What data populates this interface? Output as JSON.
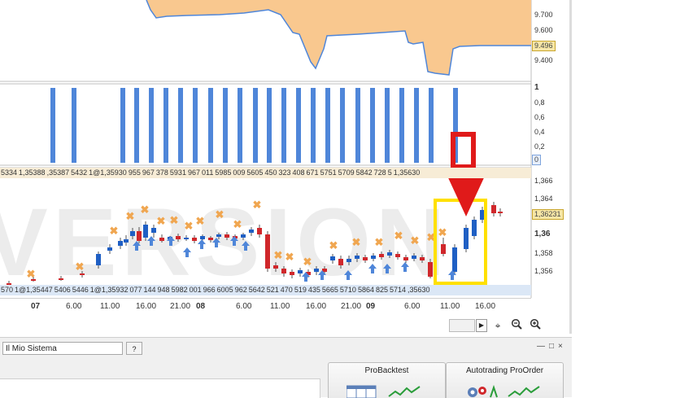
{
  "price_axis_top": [
    "9.700",
    "9.600",
    "9.400"
  ],
  "price_axis_top_current": "9.496",
  "indicator_axis": [
    "1",
    "0,8",
    "0,6",
    "0,4",
    "0,2",
    "0"
  ],
  "price_axis_main": [
    "1,366",
    "1,364",
    "1,36",
    "1,358",
    "1,356"
  ],
  "price_axis_main_current": "1,36231",
  "label_strip_top": [
    "5334",
    "1,35388",
    ",35387",
    "5432",
    "1@1,35930",
    "955",
    "967",
    "378",
    "5931",
    "967",
    "011",
    "5985",
    "009",
    "5605",
    "450",
    "323",
    "408",
    "671",
    "5751",
    "5709",
    "5842",
    "728",
    "5",
    "1,35630"
  ],
  "label_strip_bottom": [
    "570",
    "1@1,35447",
    "5406",
    "5446",
    "1@1,35932",
    "077",
    "144",
    "948",
    "5982",
    "001",
    "966",
    "6005",
    "962",
    "5642",
    "521",
    "470",
    "519",
    "435",
    "5665",
    "5710",
    "5864",
    "825",
    "5714",
    ",35630"
  ],
  "date_axis": {
    "labels": [
      {
        "text": "07",
        "day": true
      },
      {
        "text": "6.00",
        "day": false
      },
      {
        "text": "11.00",
        "day": false
      },
      {
        "text": "16.00",
        "day": false
      },
      {
        "text": "21.00",
        "day": false
      },
      {
        "text": "08",
        "day": true
      },
      {
        "text": "6.00",
        "day": false
      },
      {
        "text": "11.00",
        "day": false
      },
      {
        "text": "16.00",
        "day": false
      },
      {
        "text": "21.00",
        "day": false
      },
      {
        "text": "09",
        "day": true
      },
      {
        "text": "6.00",
        "day": false
      },
      {
        "text": "11.00",
        "day": false
      },
      {
        "text": "16.00",
        "day": false
      }
    ]
  },
  "watermark": "VERSION",
  "toolbar": {
    "icons": [
      "play-icon",
      "zoom-fit-icon",
      "zoom-out-icon",
      "zoom-in-icon"
    ]
  },
  "bottom": {
    "system_name": "Il Mio Sistema",
    "help_label": "?",
    "window_controls": [
      "—",
      "□",
      "×"
    ],
    "probacktest_label": "ProBacktest",
    "autotrading_label": "Autotrading ProOrder"
  },
  "colors": {
    "equity_fill": "#f9c88f",
    "indicator_bar": "#4f86d9",
    "bull_candle": "#1f5fc4",
    "bear_candle": "#d0272b",
    "entry_marker": "#f0a650",
    "exit_marker": "#4f86d9",
    "highlight_box": "#ffe000",
    "arrow_red": "#e01a1a"
  }
}
